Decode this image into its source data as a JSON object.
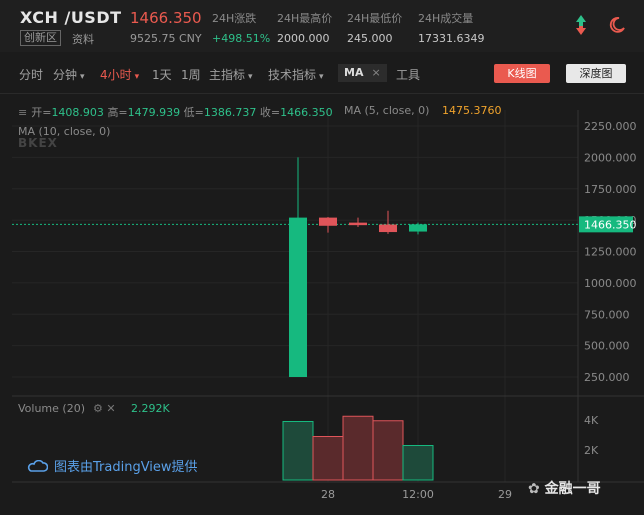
{
  "header": {
    "pair": "XCH /USDT",
    "zone_badge": "创新区",
    "info_link": "资料",
    "price": "1466.350",
    "price_cny": "9525.75 CNY",
    "stats": [
      {
        "label": "24H涨跌",
        "value": "+498.51%",
        "color": "#2ec08a"
      },
      {
        "label": "24H最高价",
        "value": "2000.000",
        "color": "#c8c8c8"
      },
      {
        "label": "24H最低价",
        "value": "245.000",
        "color": "#c8c8c8"
      },
      {
        "label": "24H成交量",
        "value": "17331.6349",
        "color": "#c8c8c8"
      }
    ],
    "icons": [
      "up-down-arrow-icon",
      "moon-icon"
    ]
  },
  "toolbar": {
    "items": [
      "分时",
      "分钟",
      "4小时",
      "1天",
      "1周",
      "主指标",
      "技术指标"
    ],
    "active": "4小时",
    "ma_chip": "MA",
    "ma_chip_close": "×",
    "tools": "工具",
    "kline": "K线图",
    "depth": "深度图"
  },
  "legend": {
    "open_label": "开=",
    "open": "1408.903",
    "high_label": "高=",
    "high": "1479.939",
    "low_label": "低=",
    "low": "1386.737",
    "close_label": "收=",
    "close": "1466.350",
    "ma5_label": "MA (5, close, 0)",
    "ma5_value": "1475.3760",
    "ma10_label": "MA (10, close, 0)",
    "watermark": "BKEX"
  },
  "volume": {
    "label": "Volume (20)",
    "value": "2.292K",
    "ticks": [
      "4K",
      "2K"
    ]
  },
  "credit": "图表由TradingView提供",
  "wechat_account": "金融一哥",
  "chart_data": {
    "type": "candlestick",
    "price_ticks": [
      "2250.000",
      "2000.000",
      "1750.000",
      "1500.000",
      "1250.000",
      "1000.000",
      "750.000",
      "500.000",
      "250.000"
    ],
    "price_ylim": [
      250,
      2250
    ],
    "current_price": "1466.350",
    "x_ticks": [
      "28",
      "12:00",
      "29"
    ],
    "candles": [
      {
        "open": 250,
        "high": 2000,
        "low": 250,
        "close": 1520,
        "dir": "up"
      },
      {
        "open": 1520,
        "high": 1525,
        "low": 1400,
        "close": 1455,
        "dir": "down"
      },
      {
        "open": 1480,
        "high": 1520,
        "low": 1445,
        "close": 1460,
        "dir": "down"
      },
      {
        "open": 1465,
        "high": 1575,
        "low": 1390,
        "close": 1405,
        "dir": "down"
      },
      {
        "open": 1408.903,
        "high": 1479.939,
        "low": 1386.737,
        "close": 1466.35,
        "dir": "up"
      }
    ],
    "volumes": [
      3900,
      2900,
      4250,
      3950,
      2300
    ],
    "volume_ylim": [
      0,
      5000
    ],
    "up_color": "#16b97f",
    "down_color": "#e0555a"
  }
}
